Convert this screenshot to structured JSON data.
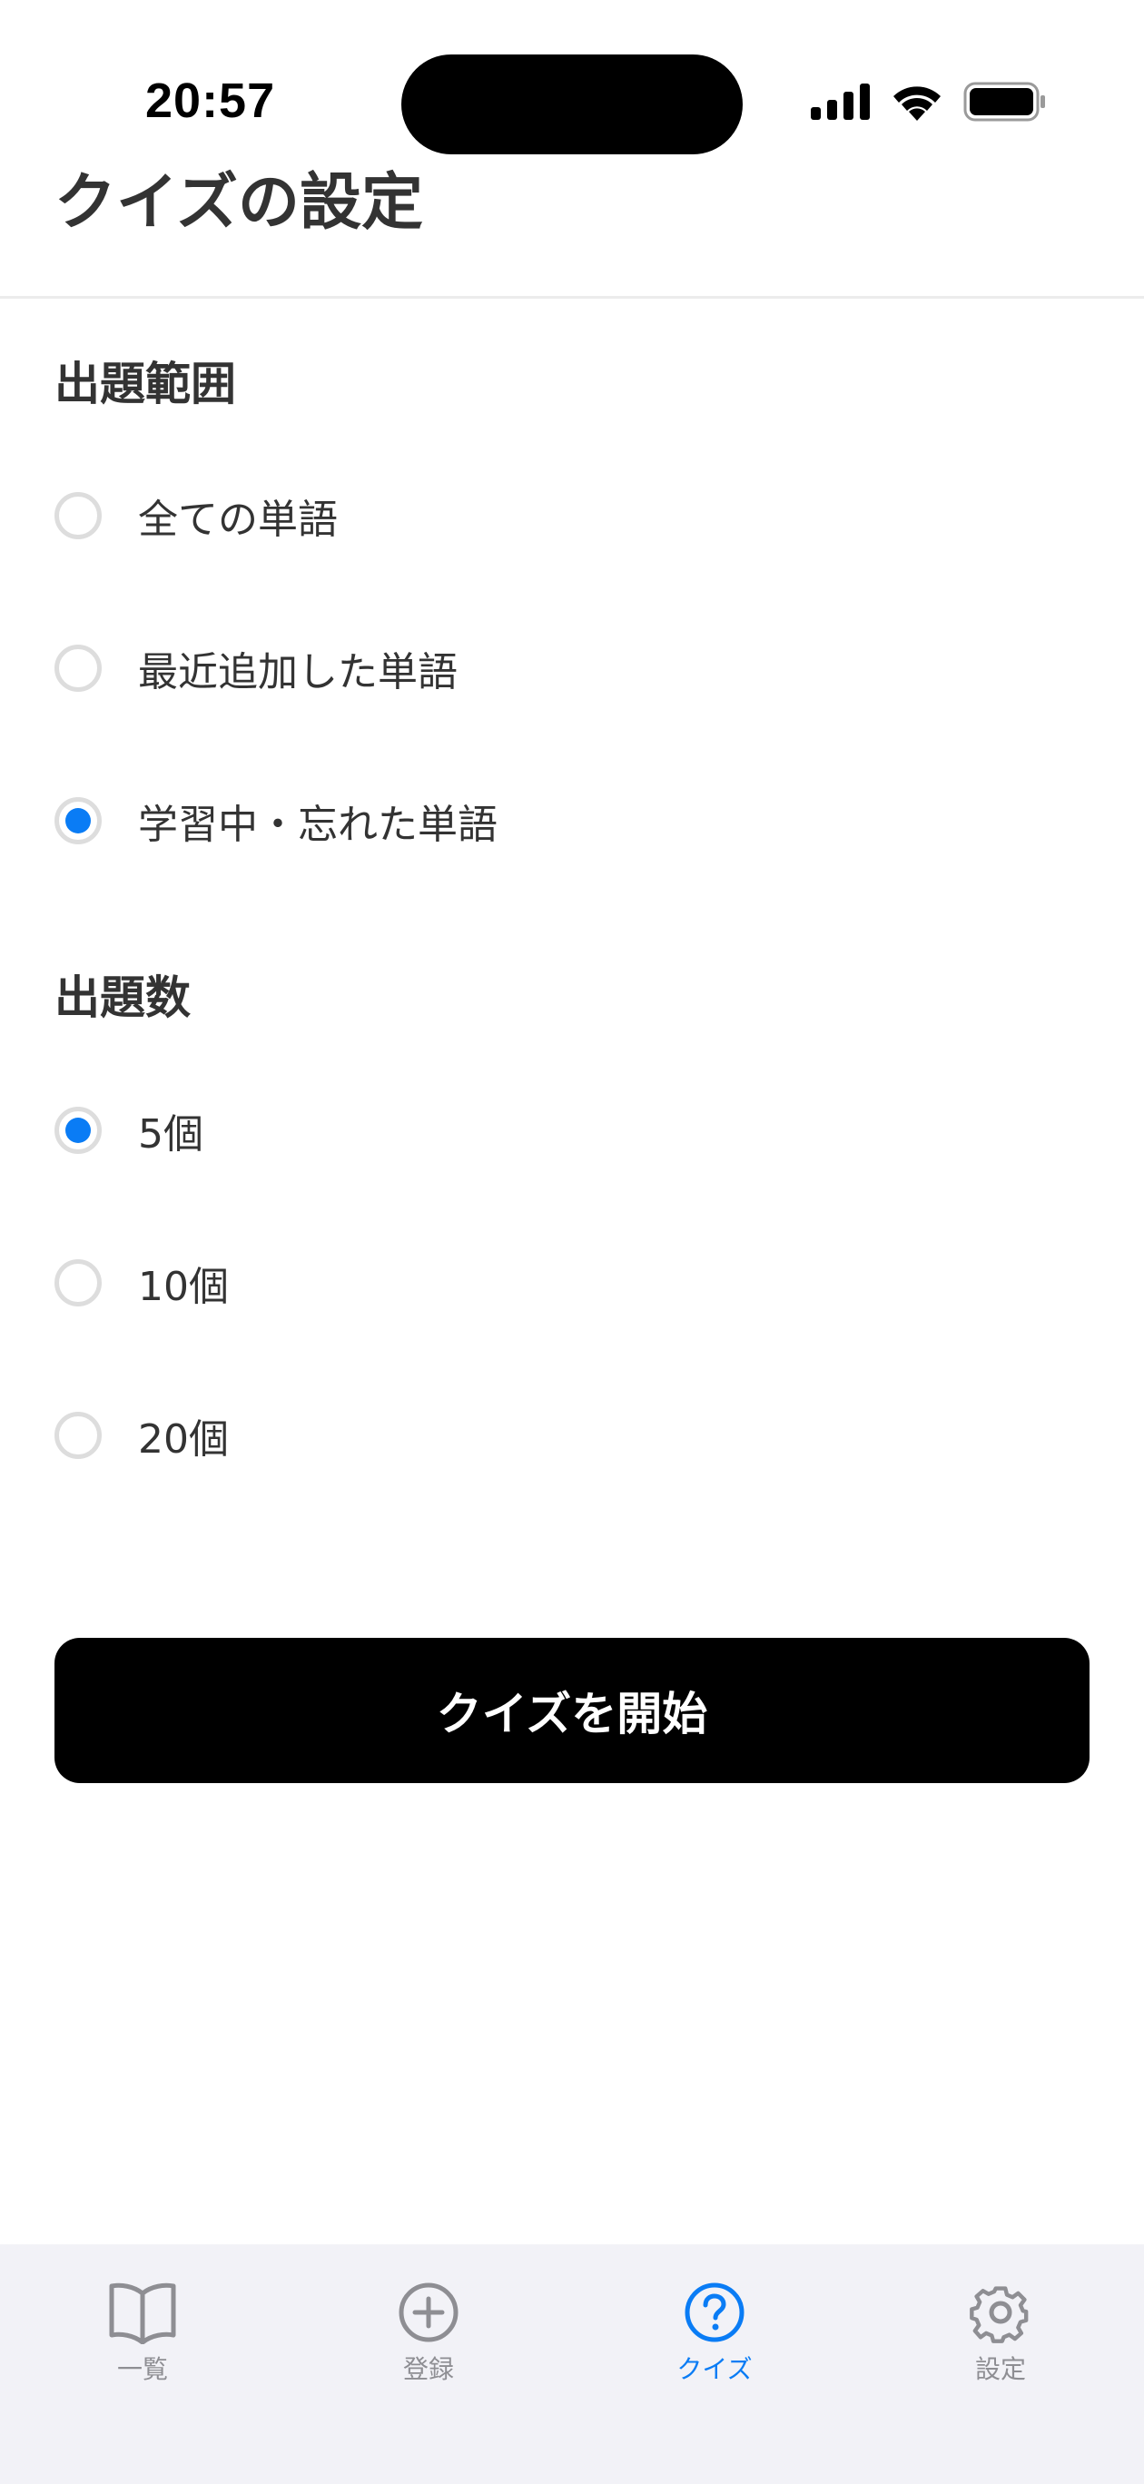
{
  "status_bar": {
    "time": "20:57",
    "icons": [
      "signal-icon",
      "wifi-icon",
      "battery-icon"
    ]
  },
  "header": {
    "title": "クイズの設定"
  },
  "range_section": {
    "title": "出題範囲",
    "options": [
      {
        "label": "全ての単語",
        "selected": false
      },
      {
        "label": "最近追加した単語",
        "selected": false
      },
      {
        "label": "学習中・忘れた単語",
        "selected": true
      }
    ]
  },
  "count_section": {
    "title": "出題数",
    "options": [
      {
        "label": "5個",
        "selected": true
      },
      {
        "label": "10個",
        "selected": false
      },
      {
        "label": "20個",
        "selected": false
      }
    ]
  },
  "start_button": {
    "label": "クイズを開始"
  },
  "tab_bar": {
    "tabs": [
      {
        "label": "一覧",
        "icon": "book-icon",
        "active": false
      },
      {
        "label": "登録",
        "icon": "plus-circle-icon",
        "active": false
      },
      {
        "label": "クイズ",
        "icon": "question-circle-icon",
        "active": true
      },
      {
        "label": "設定",
        "icon": "gear-icon",
        "active": false
      }
    ]
  },
  "colors": {
    "accent": "#0a7cf5",
    "text": "#333333",
    "button_bg": "#000000",
    "tab_bar_bg": "#f2f2f7",
    "inactive_tab": "#8e8e93"
  }
}
